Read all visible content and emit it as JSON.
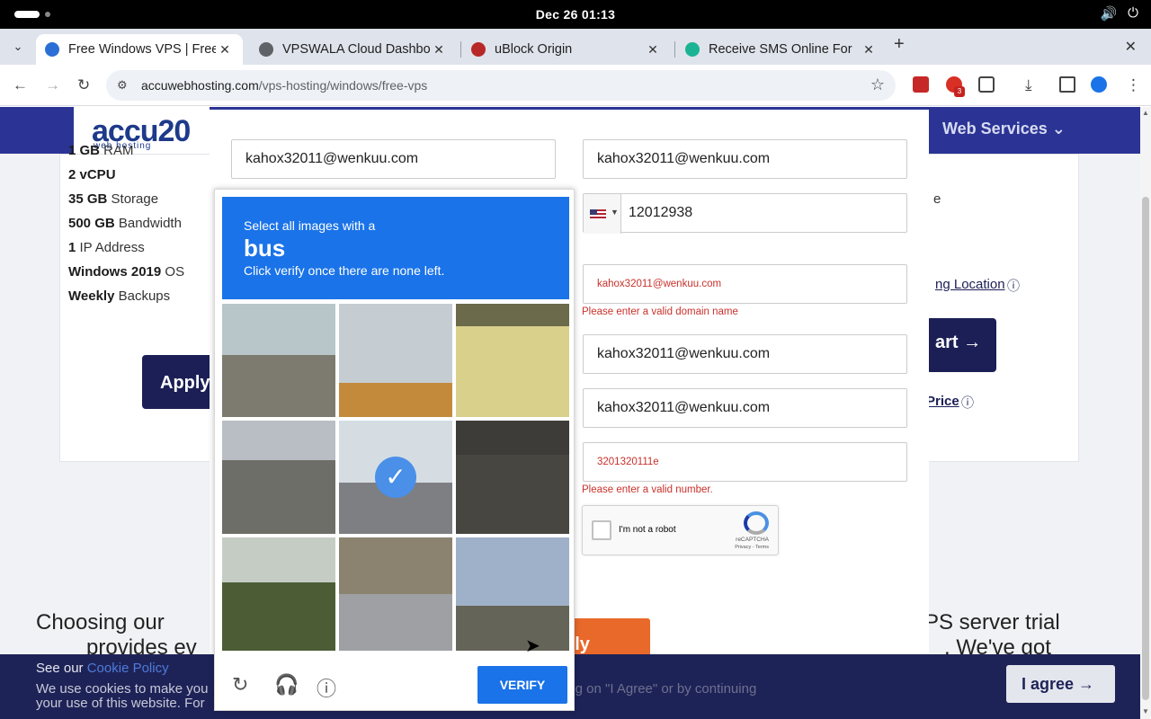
{
  "os": {
    "clock": "Dec 26  01:13",
    "volume_icon": "🔊",
    "power_icon": "⏻"
  },
  "tabs": [
    {
      "title": "Free Windows VPS | Free",
      "fav_color": "#2b6fd6"
    },
    {
      "title": "VPSWALA Cloud Dashbo",
      "fav_color": "#5f6368"
    },
    {
      "title": "uBlock Origin",
      "fav_color": "#b82828"
    },
    {
      "title": "Receive SMS Online For",
      "fav_color": "#1ab394"
    }
  ],
  "address": {
    "domain": "accuwebhosting.com",
    "path": "/vps-hosting/windows/free-vps"
  },
  "site": {
    "logo": "accu",
    "logo_digits": "20",
    "logo_sub": "web hosting",
    "nav_web_services": "Web Services",
    "specs": [
      {
        "bold": "1 GB",
        "rest": " RAM"
      },
      {
        "bold": "2 vCPU",
        "rest": ""
      },
      {
        "bold": "35 GB",
        "rest": " Storage"
      },
      {
        "bold": "500 GB",
        "rest": " Bandwidth"
      },
      {
        "bold": "1",
        "rest": " IP Address"
      },
      {
        "bold": "Windows 2019",
        "rest": " OS"
      },
      {
        "bold": "Weekly",
        "rest": " Backups"
      }
    ],
    "apply_ghost": "Apply",
    "location_link": "ng Location",
    "price_link": "Price",
    "cart": "art",
    "bottom_left": "Choosing our",
    "bottom_right": "PS server trial",
    "bottom_left_2": "provides ev",
    "bottom_right_2": ". We've got",
    "right_e": "e"
  },
  "form": {
    "field_1": "kahox32011@wenkuu.com",
    "field_2": "kahox32011@wenkuu.com",
    "phone": "12012938",
    "field_err_1": "kahox32011@wenkuu.com",
    "err_1": "Please enter a valid domain name",
    "field_3": "kahox32011@wenkuu.com",
    "field_4": "kahox32011@wenkuu.com",
    "field_err_2": "3201320111e",
    "err_2": "Please enter a valid number.",
    "robot": "I'm not a robot",
    "recaptcha": "reCAPTCHA",
    "recaptcha_terms": "Privacy - Terms",
    "apply": "ply"
  },
  "cookie": {
    "see_our": "See our ",
    "policy": "Cookie Policy",
    "line2": "We use cookies to make you",
    "line2b": "ing on \"I Agree\" or by continuing",
    "line3": "your use of this website. For",
    "agree": "I agree"
  },
  "captcha": {
    "prompt": "Select all images with a",
    "target": "bus",
    "instruction": "Click verify once there are none left.",
    "verify": "VERIFY",
    "tiles": [
      {
        "sky": "#b8c6c9",
        "gnd": "#7d7b70",
        "split": 45,
        "selected": false
      },
      {
        "sky": "#c5cdd3",
        "gnd": "#c28a3a",
        "split": 70,
        "selected": false
      },
      {
        "sky": "#6b6a4a",
        "gnd": "#d9d08c",
        "split": 20,
        "selected": false
      },
      {
        "sky": "#b9bec4",
        "gnd": "#6e6e68",
        "split": 35,
        "selected": false
      },
      {
        "sky": "#d5dde3",
        "gnd": "#7d7f82",
        "split": 55,
        "selected": true
      },
      {
        "sky": "#3e3c39",
        "gnd": "#484640",
        "split": 30,
        "selected": false
      },
      {
        "sky": "#c5ccc4",
        "gnd": "#4c5d36",
        "split": 40,
        "selected": false
      },
      {
        "sky": "#8b8270",
        "gnd": "#9ea0a3",
        "split": 50,
        "selected": false
      },
      {
        "sky": "#9fb1c8",
        "gnd": "#646558",
        "split": 60,
        "selected": false
      }
    ]
  }
}
